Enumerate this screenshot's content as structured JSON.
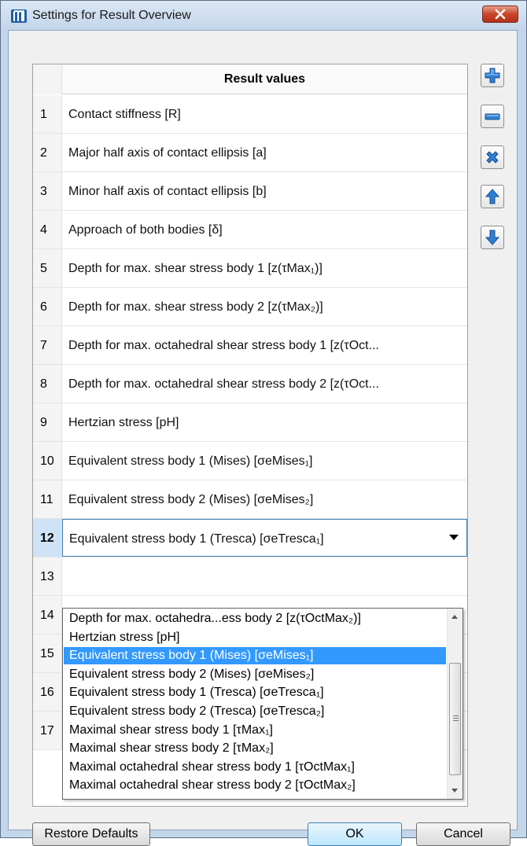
{
  "window": {
    "title": "Settings for Result Overview"
  },
  "grid": {
    "header": "Result values",
    "rows": [
      {
        "num": "1",
        "value": "Contact stiffness [R]"
      },
      {
        "num": "2",
        "value": "Major half axis of contact ellipsis [a]"
      },
      {
        "num": "3",
        "value": "Minor half axis of contact ellipsis [b]"
      },
      {
        "num": "4",
        "value": "Approach of both bodies [δ]"
      },
      {
        "num": "5",
        "value": "Depth for max. shear stress body 1 [z(τMax₁)]"
      },
      {
        "num": "6",
        "value": "Depth for max. shear stress body 2 [z(τMax₂)]"
      },
      {
        "num": "7",
        "value": "Depth for max. octahedral shear stress body 1 [z(τOct..."
      },
      {
        "num": "8",
        "value": "Depth for max. octahedral shear stress body 2 [z(τOct..."
      },
      {
        "num": "9",
        "value": "Hertzian stress [pH]"
      },
      {
        "num": "10",
        "value": "Equivalent stress body 1 (Mises) [σeMises₁]"
      },
      {
        "num": "11",
        "value": "Equivalent stress body 2 (Mises) [σeMises₂]"
      },
      {
        "num": "12",
        "value": "Equivalent stress body 1 (Tresca) [σeTresca₁]"
      },
      {
        "num": "13",
        "value": ""
      },
      {
        "num": "14",
        "value": ""
      },
      {
        "num": "15",
        "value": ""
      },
      {
        "num": "16",
        "value": ""
      },
      {
        "num": "17",
        "value": ""
      }
    ],
    "selected_row": "12"
  },
  "dropdown": {
    "options": [
      "Depth for max. octahedra...ess body 2 [z(τOctMax₂)]",
      "Hertzian stress [pH]",
      "Equivalent stress body 1 (Mises) [σeMises₁]",
      "Equivalent stress body 2 (Mises) [σeMises₂]",
      "Equivalent stress body 1 (Tresca) [σeTresca₁]",
      "Equivalent stress body 2 (Tresca) [σeTresca₂]",
      "Maximal shear stress body 1 [τMax₁]",
      "Maximal shear stress body 2 [τMax₂]",
      "Maximal octahedral shear stress body 1 [τOctMax₁]",
      "Maximal octahedral shear stress body 2 [τOctMax₂]"
    ],
    "highlighted": "Equivalent stress body 1 (Mises) [σeMises₁]"
  },
  "side_buttons": [
    "add-icon",
    "remove-icon",
    "delete-icon",
    "move-up-icon",
    "move-down-icon"
  ],
  "buttons": {
    "restore": "Restore Defaults",
    "ok": "OK",
    "cancel": "Cancel"
  },
  "colors": {
    "accent": "#3399ff",
    "icon_blue": "#2f7fd6",
    "close_red": "#c9452a"
  }
}
